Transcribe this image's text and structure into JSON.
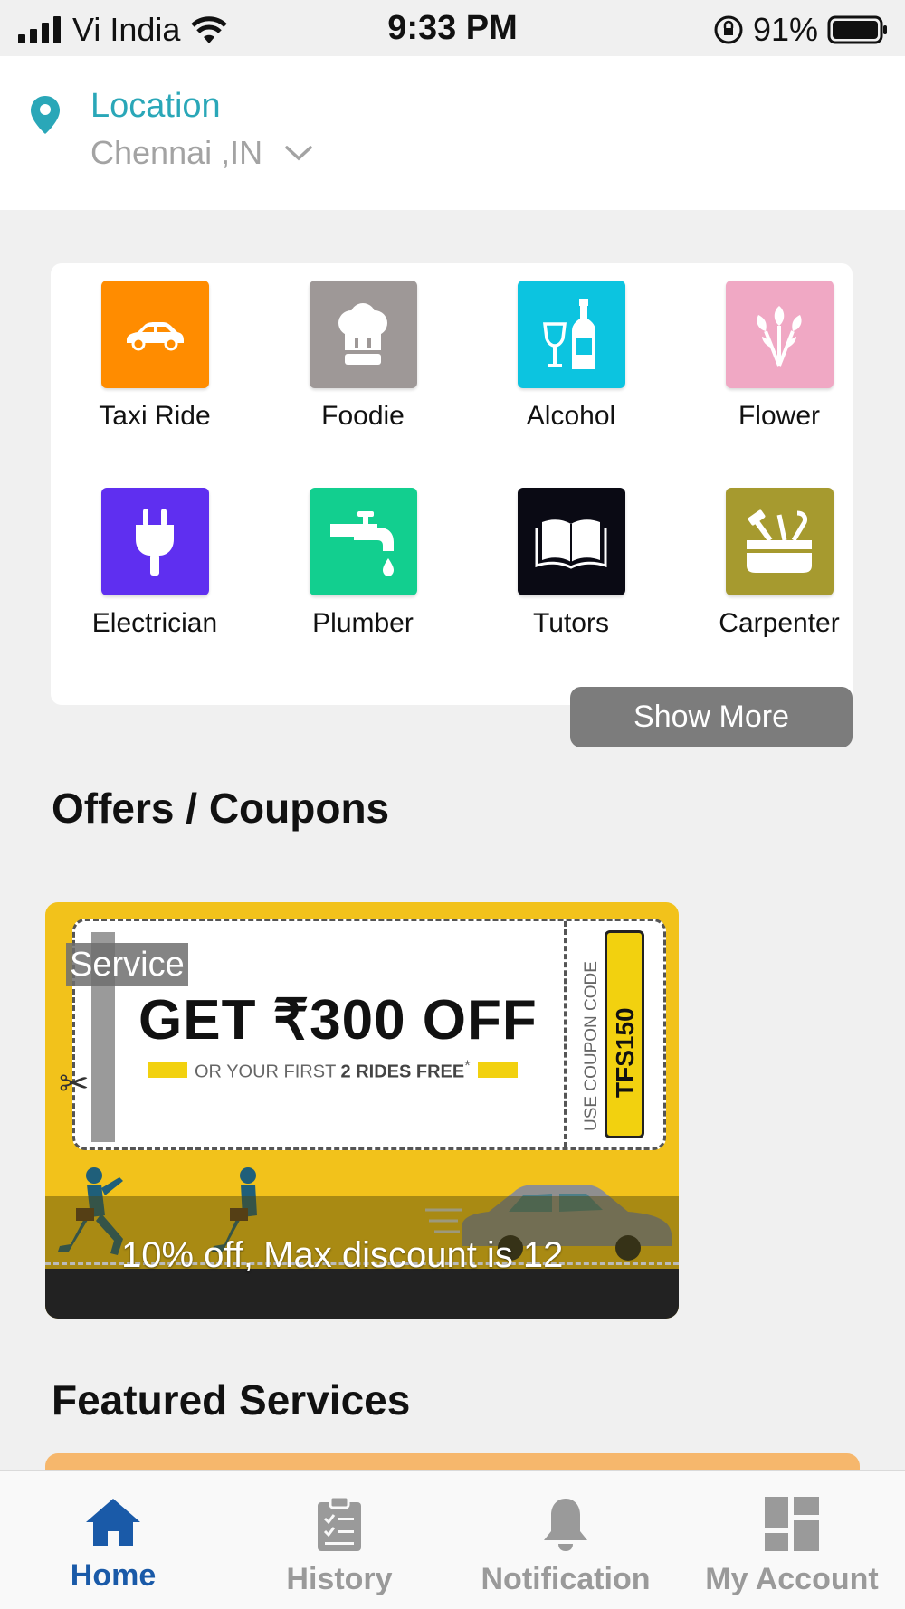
{
  "status_bar": {
    "carrier": "Vi India",
    "time": "9:33 PM",
    "battery": "91%"
  },
  "location": {
    "label": "Location",
    "value": "Chennai ,IN"
  },
  "categories": [
    {
      "label": "Taxi Ride",
      "color": "#ff8c00",
      "icon": "car-icon"
    },
    {
      "label": "Foodie",
      "color": "#9e9897",
      "icon": "chef-hat-icon"
    },
    {
      "label": "Alcohol",
      "color": "#0cc4e0",
      "icon": "wine-bottle-icon"
    },
    {
      "label": "Flower",
      "color": "#f0a8c4",
      "icon": "flower-icon"
    },
    {
      "label": "Electrician",
      "color": "#5f2ff0",
      "icon": "plug-icon"
    },
    {
      "label": "Plumber",
      "color": "#12cf8f",
      "icon": "tap-icon"
    },
    {
      "label": "Tutors",
      "color": "#0a0a14",
      "icon": "book-icon"
    },
    {
      "label": "Carpenter",
      "color": "#a69a2f",
      "icon": "toolbox-icon"
    }
  ],
  "show_more": "Show More",
  "offers": {
    "title": "Offers / Coupons",
    "coupon": {
      "tag": "Service",
      "headline": "GET ₹300 OFF",
      "sub_prefix": "OR YOUR FIRST ",
      "sub_bold": "2 RIDES FREE",
      "sub_suffix": "*",
      "code_label": "USE COUPON CODE",
      "code": "TFS150",
      "description": "10% off, Max discount is 12"
    }
  },
  "featured": {
    "title": "Featured Services"
  },
  "tabs": [
    {
      "label": "Home",
      "icon": "home-icon",
      "active": true
    },
    {
      "label": "History",
      "icon": "clipboard-icon",
      "active": false
    },
    {
      "label": "Notification",
      "icon": "bell-icon",
      "active": false
    },
    {
      "label": "My Account",
      "icon": "dashboard-icon",
      "active": false
    }
  ],
  "colors": {
    "accent": "#2aa7b8",
    "active_tab": "#1a5aa8",
    "inactive_tab": "#9a9a9a"
  }
}
